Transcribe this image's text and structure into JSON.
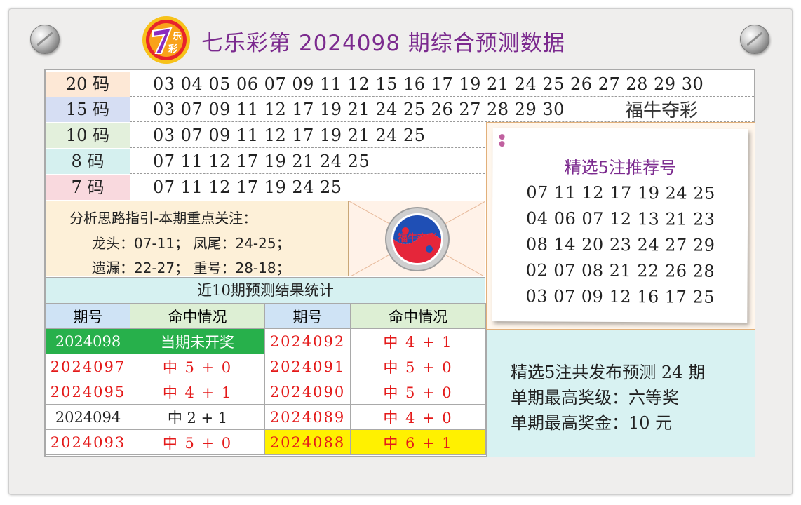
{
  "header": {
    "title": "七乐彩第 2024098 期综合预测数据",
    "logo_text": "7乐彩"
  },
  "code_rows": [
    {
      "label": "20 码",
      "numbers": "03 04 05 06 07 09 11 12 15 16 17 19 21 24 25 26 27 28 29 30",
      "color": "#fde8d6"
    },
    {
      "label": "15 码",
      "numbers": "03 07 09 11 12 17 19 21 24 25 26 27 28 29 30",
      "color": "#d6def3"
    },
    {
      "label": "10 码",
      "numbers": "03 07 09 11 12 17 19 21 24 25",
      "color": "#e3f0dc"
    },
    {
      "label": "8 码",
      "numbers": "07 11 12 17 19 21 24 25",
      "color": "#d5f0ef"
    },
    {
      "label": "7 码",
      "numbers": "07 11 12 17 19 24 25",
      "color": "#f9d9de"
    }
  ],
  "brand": "福牛夺彩",
  "recommend": {
    "title": "精选5注推荐号",
    "lines": [
      "07 11 12 17 19 24 25",
      "04 06 07 12 13 21 23",
      "08 14 20 23 24 27 29",
      "02 07 08 21 22 26 28",
      "03 07 09 12 16 17 25"
    ]
  },
  "analysis": {
    "heading": "分析思路指引-本期重点关注：",
    "line1": "龙头：07-11；  凤尾：24-25；",
    "line2": "遗漏：22-27；  重号：28-18；"
  },
  "badge_text": "福牛夺彩",
  "stats": {
    "title": "近10期预测结果统计",
    "col_period": "期号",
    "col_hit": "命中情况",
    "rows": [
      {
        "p1": "2024098",
        "h1": "当期未开奖",
        "p2": "2024092",
        "h2": "中 4 + 1"
      },
      {
        "p1": "2024097",
        "h1": "中 5 + 0",
        "p2": "2024091",
        "h2": "中 5 + 0"
      },
      {
        "p1": "2024095",
        "h1": "中 4 + 1",
        "p2": "2024090",
        "h2": "中 5 + 0"
      },
      {
        "p1": "2024094",
        "h1": "中 2 + 1",
        "p2": "2024089",
        "h2": "中 4 + 0"
      },
      {
        "p1": "2024093",
        "h1": "中 5 + 0",
        "p2": "2024088",
        "h2": "中 6 + 1"
      }
    ]
  },
  "summary": {
    "line1": "精选5注共发布预测 24 期",
    "line2": "单期最高奖级：六等奖",
    "line3": "单期最高奖金：10 元"
  }
}
